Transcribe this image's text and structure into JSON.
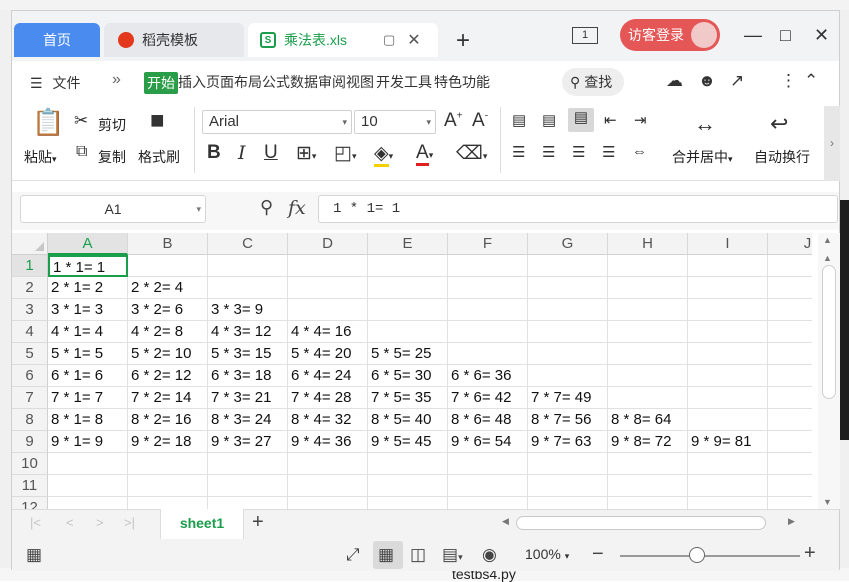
{
  "tabs": {
    "home": "首页",
    "docer": "稻壳模板",
    "file": "乘法表.xls"
  },
  "login": {
    "label": "访客登录"
  },
  "window_count": "1",
  "menu": {
    "file": "文件",
    "items": [
      "开始",
      "插入",
      "页面布局",
      "公式",
      "数据",
      "审阅",
      "视图",
      "开发工具",
      "特色功能"
    ],
    "search": "查找"
  },
  "ribbon": {
    "paste": "粘贴",
    "cut": "剪切",
    "copy": "复制",
    "format_painter": "格式刷",
    "font_name": "Arial",
    "font_size": "10",
    "merge_center": "合并居中",
    "wrap_text": "自动换行"
  },
  "formula_bar": {
    "name_box": "A1",
    "formula": "1 * 1= 1"
  },
  "columns": [
    "A",
    "B",
    "C",
    "D",
    "E",
    "F",
    "G",
    "H",
    "I",
    "J"
  ],
  "rows": [
    "1",
    "2",
    "3",
    "4",
    "5",
    "6",
    "7",
    "8",
    "9",
    "10",
    "11",
    "12"
  ],
  "cells": [
    [
      "1 * 1= 1"
    ],
    [
      "2 * 1= 2",
      "2 * 2= 4"
    ],
    [
      "3 * 1= 3",
      "3 * 2= 6",
      "3 * 3= 9"
    ],
    [
      "4 * 1= 4",
      "4 * 2= 8",
      "4 * 3= 12",
      "4 * 4= 16"
    ],
    [
      "5 * 1= 5",
      "5 * 2= 10",
      "5 * 3= 15",
      "5 * 4= 20",
      "5 * 5= 25"
    ],
    [
      "6 * 1= 6",
      "6 * 2= 12",
      "6 * 3= 18",
      "6 * 4= 24",
      "6 * 5= 30",
      "6 * 6= 36"
    ],
    [
      "7 * 1= 7",
      "7 * 2= 14",
      "7 * 3= 21",
      "7 * 4= 28",
      "7 * 5= 35",
      "7 * 6= 42",
      "7 * 7= 49"
    ],
    [
      "8 * 1= 8",
      "8 * 2= 16",
      "8 * 3= 24",
      "8 * 4= 32",
      "8 * 5= 40",
      "8 * 6= 48",
      "8 * 7= 56",
      "8 * 8= 64"
    ],
    [
      "9 * 1= 9",
      "9 * 2= 18",
      "9 * 3= 27",
      "9 * 4= 36",
      "9 * 5= 45",
      "9 * 6= 54",
      "9 * 7= 63",
      "9 * 8= 72",
      "9 * 9= 81"
    ]
  ],
  "selected_cell": "A1",
  "sheet": {
    "name": "sheet1"
  },
  "status": {
    "zoom": "100%",
    "zoom_level": 100
  },
  "desktop": {
    "file_label": "testbs4.py"
  },
  "colors": {
    "accent": "#1a9e4b",
    "home_tab": "#4a8bef",
    "login": "#e55656"
  }
}
